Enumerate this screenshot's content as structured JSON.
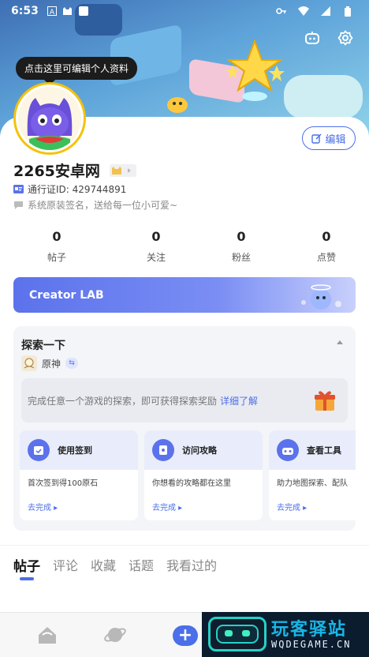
{
  "status_bar": {
    "time": "6:53"
  },
  "profile": {
    "tooltip": "点击这里可编辑个人资料",
    "edit_label": "编辑",
    "username": "2265安卓网",
    "pass_id": "通行证ID: 429744891",
    "signature": "系统原装签名，送给每一位小可爱~"
  },
  "stats": [
    {
      "value": "0",
      "label": "帖子"
    },
    {
      "value": "0",
      "label": "关注"
    },
    {
      "value": "0",
      "label": "粉丝"
    },
    {
      "value": "0",
      "label": "点赞"
    }
  ],
  "creator_lab": {
    "label": "Creator LAB"
  },
  "explore": {
    "title": "探索一下",
    "game": "原神",
    "hint": "完成任意一个游戏的探索，即可获得探索奖励",
    "hint_link": "详细了解",
    "tasks": [
      {
        "title": "使用签到",
        "desc": "首次签到得100原石",
        "action": "去完成",
        "icon": "calendar-check-icon"
      },
      {
        "title": "访问攻略",
        "desc": "你想看的攻略都在这里",
        "action": "去完成",
        "icon": "guide-icon"
      },
      {
        "title": "查看工具",
        "desc": "助力地图探索、配队",
        "action": "去完成",
        "icon": "toolbox-icon"
      }
    ]
  },
  "tabs": [
    "帖子",
    "评论",
    "收藏",
    "话题",
    "我看过的"
  ],
  "watermark": {
    "title": "玩客驿站",
    "subtitle": "WQDEGAME.CN"
  },
  "colors": {
    "accent": "#4a6fe8",
    "avatar_ring": "#f5c20a",
    "creator_lab": "#5b72ec"
  }
}
